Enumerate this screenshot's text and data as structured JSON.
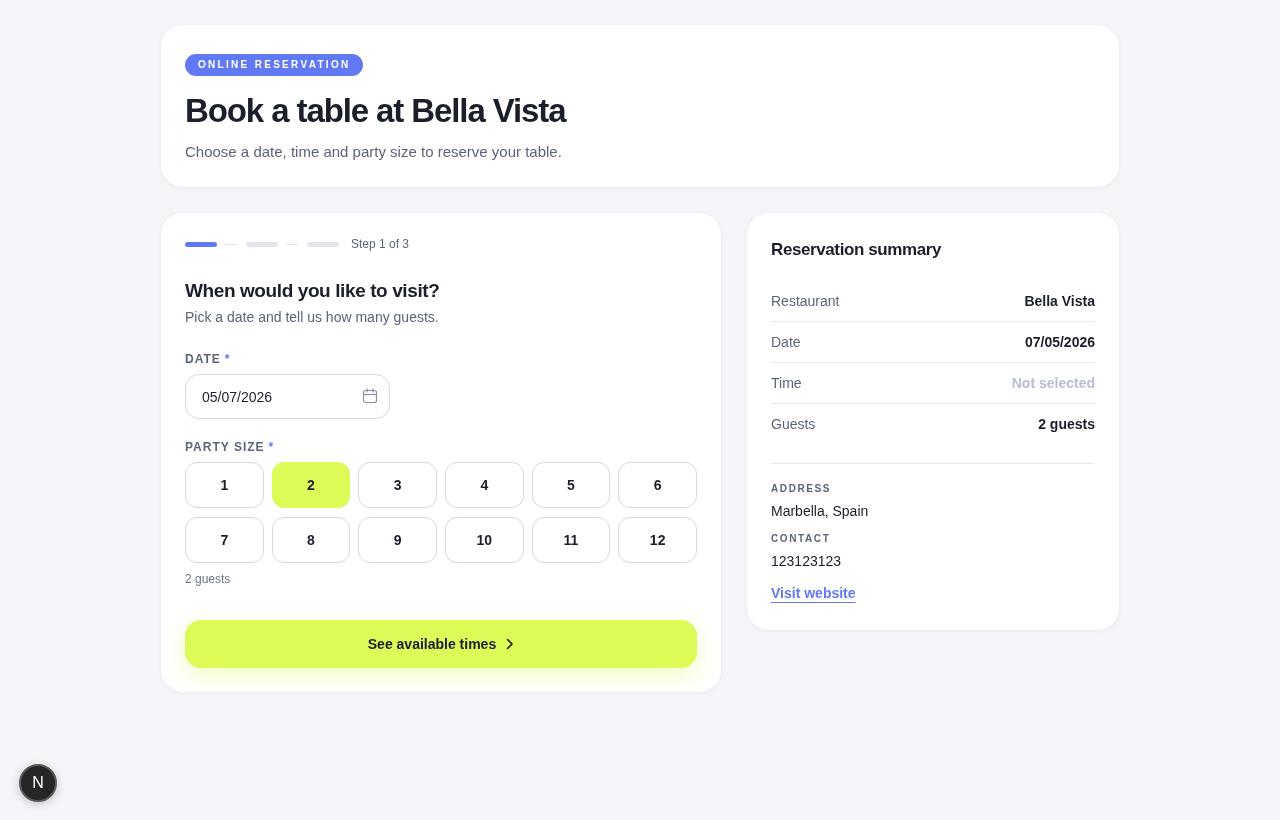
{
  "header": {
    "badge": "ONLINE RESERVATION",
    "title": "Book a table at Bella Vista",
    "subtitle": "Choose a date, time and party size to reserve your table."
  },
  "booking_form": {
    "steps": [
      {
        "active": true
      },
      {
        "active": false
      },
      {
        "active": false
      }
    ],
    "step_label": "Step 1 of 3",
    "heading": "When would you like to visit?",
    "description": "Pick a date and tell us how many guests.",
    "date_field": {
      "label": "DATE",
      "required_mark": "*",
      "value": "05/07/2026"
    },
    "party_size": {
      "label": "PARTY SIZE",
      "required_mark": "*",
      "options": [
        {
          "label": "1",
          "selected": false
        },
        {
          "label": "2",
          "selected": true
        },
        {
          "label": "3",
          "selected": false
        },
        {
          "label": "4",
          "selected": false
        },
        {
          "label": "5",
          "selected": false
        },
        {
          "label": "6",
          "selected": false
        },
        {
          "label": "7",
          "selected": false
        },
        {
          "label": "8",
          "selected": false
        },
        {
          "label": "9",
          "selected": false
        },
        {
          "label": "10",
          "selected": false
        },
        {
          "label": "11",
          "selected": false
        },
        {
          "label": "12",
          "selected": false
        }
      ],
      "hint": "2 guests"
    },
    "submit_button": {
      "label": "See available times"
    }
  },
  "summary": {
    "title": "Reservation summary",
    "rows": [
      {
        "label": "Restaurant",
        "value": "Bella Vista",
        "muted": false
      },
      {
        "label": "Date",
        "value": "07/05/2026",
        "muted": false
      },
      {
        "label": "Time",
        "value": "Not selected",
        "muted": true
      },
      {
        "label": "Guests",
        "value": "2 guests",
        "muted": false
      }
    ],
    "details": [
      {
        "label": "ADDRESS",
        "value": "Marbella, Spain"
      },
      {
        "label": "CONTACT",
        "value": "123123123"
      }
    ],
    "link": "Visit website"
  },
  "dev_badge": {
    "label": "N"
  }
}
